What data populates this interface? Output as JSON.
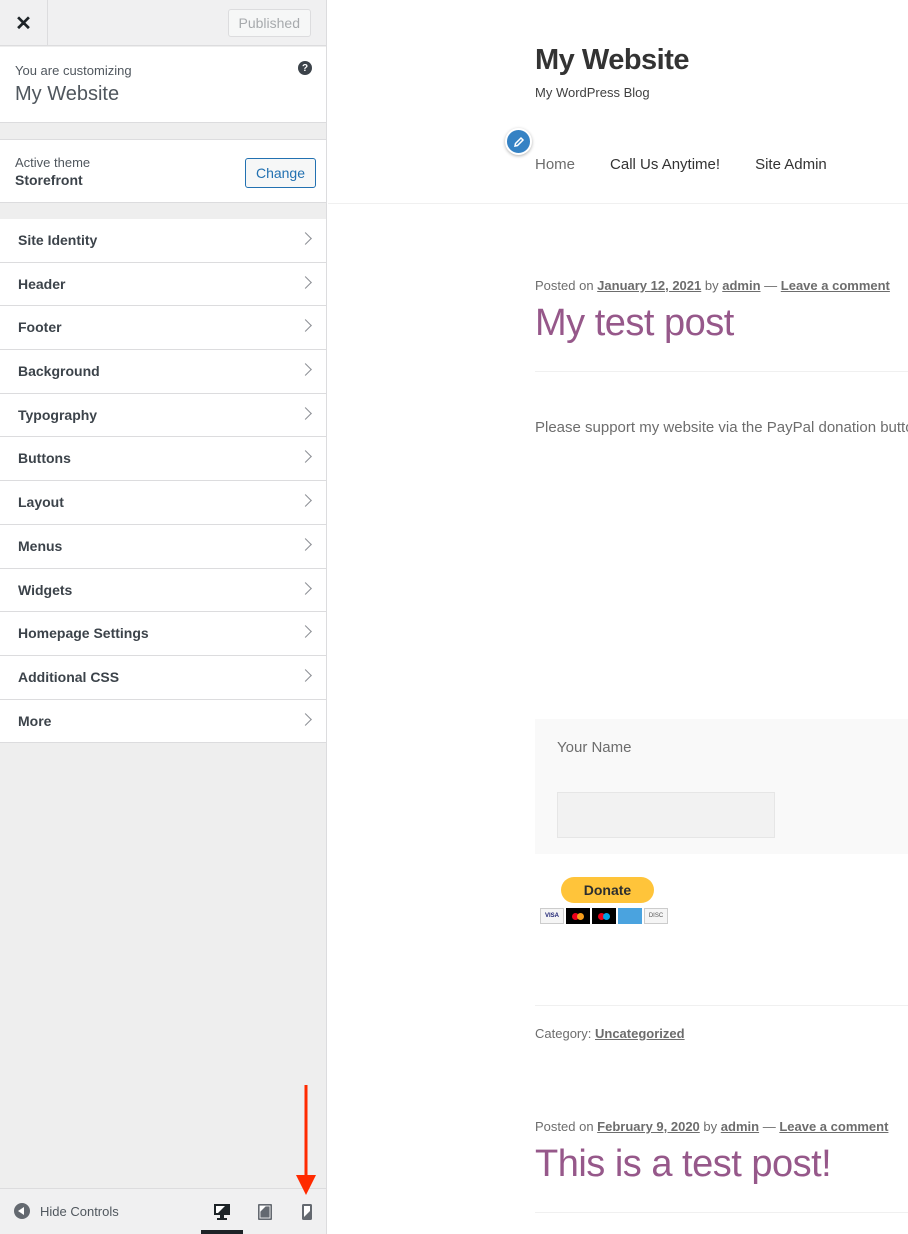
{
  "sidebar": {
    "close_label": "✕",
    "publish_button": "Published",
    "customizing_label": "You are customizing",
    "site_name": "My Website",
    "help_icon": "?",
    "active_theme_label": "Active theme",
    "active_theme_name": "Storefront",
    "change_button": "Change",
    "sections": [
      {
        "label": "Site Identity"
      },
      {
        "label": "Header"
      },
      {
        "label": "Footer"
      },
      {
        "label": "Background"
      },
      {
        "label": "Typography"
      },
      {
        "label": "Buttons"
      },
      {
        "label": "Layout"
      },
      {
        "label": "Menus"
      },
      {
        "label": "Widgets"
      },
      {
        "label": "Homepage Settings"
      },
      {
        "label": "Additional CSS"
      },
      {
        "label": "More"
      }
    ],
    "footer": {
      "hide_controls": "Hide Controls",
      "devices": [
        "desktop",
        "tablet",
        "mobile"
      ],
      "active_device": "desktop"
    }
  },
  "annotation": {
    "arrow_color": "#ff2a00",
    "points_to": "mobile-preview"
  },
  "preview": {
    "site_title": "My Website",
    "tagline": "My WordPress Blog",
    "nav": [
      "Home",
      "Call Us Anytime!",
      "Site Admin"
    ],
    "posts": [
      {
        "posted_on": "Posted on",
        "date": "January 12, 2021",
        "by": "by",
        "author": "admin",
        "dash": "—",
        "comment_link": "Leave a comment",
        "title": "My test post",
        "excerpt": "Please support my website via the PayPal donation butto",
        "form_label": "Your Name",
        "form_value": "",
        "donate_label": "Donate",
        "cards": [
          "VISA",
          "Mastercard",
          "Maestro",
          "Amex",
          "Discover"
        ],
        "category_label": "Category:",
        "category": "Uncategorized"
      },
      {
        "posted_on": "Posted on",
        "date": "February 9, 2020",
        "by": "by",
        "author": "admin",
        "dash": "—",
        "comment_link": "Leave a comment",
        "title": "This is a test post!"
      }
    ]
  },
  "colors": {
    "accent": "#2271b1",
    "post_title": "#96588a",
    "donate": "#ffc43a",
    "edit_shortcut": "#3582c4"
  }
}
